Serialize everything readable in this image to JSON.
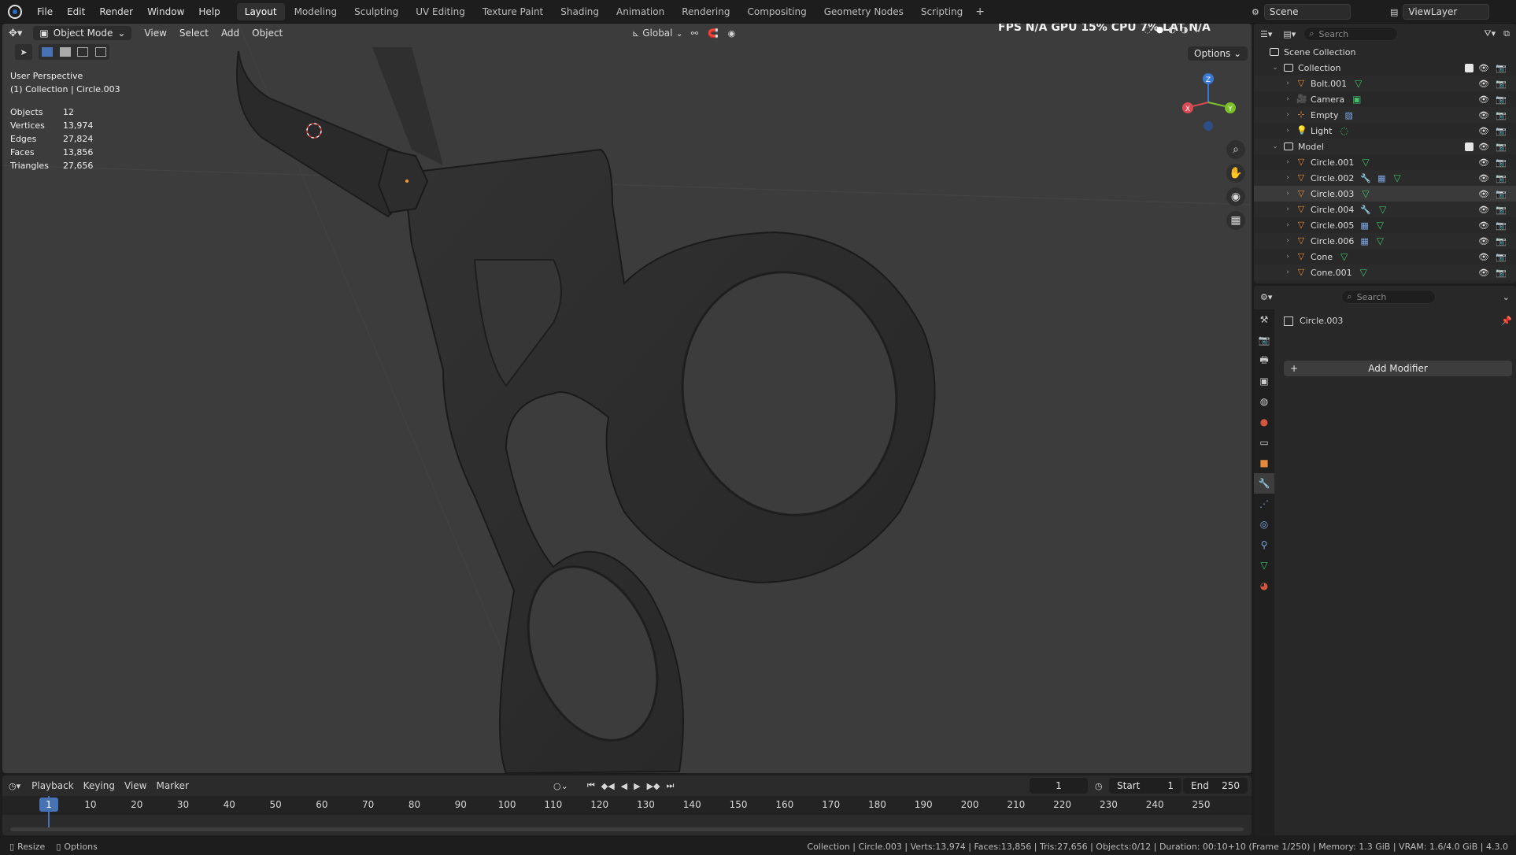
{
  "topbar": {
    "menu": [
      "File",
      "Edit",
      "Render",
      "Window",
      "Help"
    ],
    "workspaces": [
      {
        "label": "Layout",
        "active": true
      },
      {
        "label": "Modeling",
        "active": false
      },
      {
        "label": "Sculpting",
        "active": false
      },
      {
        "label": "UV Editing",
        "active": false
      },
      {
        "label": "Texture Paint",
        "active": false
      },
      {
        "label": "Shading",
        "active": false
      },
      {
        "label": "Animation",
        "active": false
      },
      {
        "label": "Rendering",
        "active": false
      },
      {
        "label": "Compositing",
        "active": false
      },
      {
        "label": "Geometry Nodes",
        "active": false
      },
      {
        "label": "Scripting",
        "active": false
      }
    ],
    "add_tab": "+",
    "scene": "Scene",
    "view_layer": "ViewLayer"
  },
  "viewport": {
    "mode": "Object Mode",
    "menus": [
      "View",
      "Select",
      "Add",
      "Object"
    ],
    "transform_orientation": "Global",
    "options_label": "Options",
    "perf_overlay": "FPS  N/A  GPU  15%  CPU  7%  LAT  N/A",
    "perspective": "User Perspective",
    "context": "(1) Collection | Circle.003",
    "stats": [
      {
        "label": "Objects",
        "value": "12"
      },
      {
        "label": "Vertices",
        "value": "13,974"
      },
      {
        "label": "Edges",
        "value": "27,824"
      },
      {
        "label": "Faces",
        "value": "13,856"
      },
      {
        "label": "Triangles",
        "value": "27,656"
      }
    ],
    "gizmo": {
      "z": "Z",
      "y": "Y",
      "x": "X"
    }
  },
  "outliner": {
    "search_placeholder": "Search",
    "root": "Scene Collection",
    "collections": [
      {
        "name": "Collection",
        "items": [
          {
            "name": "Bolt.001",
            "icon": "mesh",
            "extra": [
              "mesh"
            ]
          },
          {
            "name": "Camera",
            "icon": "camera",
            "extra": [
              "camera-data"
            ]
          },
          {
            "name": "Empty",
            "icon": "empty",
            "extra": [
              "image"
            ]
          },
          {
            "name": "Light",
            "icon": "light",
            "extra": [
              "light-data"
            ]
          }
        ]
      },
      {
        "name": "Model",
        "items": [
          {
            "name": "Circle.001",
            "icon": "mesh",
            "extra": [
              "mesh"
            ]
          },
          {
            "name": "Circle.002",
            "icon": "mesh",
            "extra": [
              "wrench",
              "modifier",
              "mesh"
            ]
          },
          {
            "name": "Circle.003",
            "icon": "mesh",
            "extra": [
              "mesh"
            ],
            "selected": true
          },
          {
            "name": "Circle.004",
            "icon": "mesh",
            "extra": [
              "wrench",
              "mesh"
            ]
          },
          {
            "name": "Circle.005",
            "icon": "mesh",
            "extra": [
              "modifier",
              "mesh"
            ]
          },
          {
            "name": "Circle.006",
            "icon": "mesh",
            "extra": [
              "modifier",
              "mesh"
            ]
          },
          {
            "name": "Cone",
            "icon": "mesh",
            "extra": [
              "mesh"
            ]
          },
          {
            "name": "Cone.001",
            "icon": "mesh",
            "extra": [
              "mesh"
            ]
          }
        ]
      }
    ]
  },
  "properties": {
    "search_placeholder": "Search",
    "object_name": "Circle.003",
    "add_modifier": "Add Modifier"
  },
  "timeline": {
    "menus": [
      "Playback",
      "Keying",
      "View",
      "Marker"
    ],
    "current_frame": "1",
    "start_label": "Start",
    "start": "1",
    "end_label": "End",
    "end": "250",
    "ticks": [
      "1",
      "10",
      "20",
      "30",
      "40",
      "50",
      "60",
      "70",
      "80",
      "90",
      "100",
      "110",
      "120",
      "130",
      "140",
      "150",
      "160",
      "170",
      "180",
      "190",
      "200",
      "210",
      "220",
      "230",
      "240",
      "250"
    ]
  },
  "statusbar": {
    "left": [
      "Resize",
      "Options"
    ],
    "right": "Collection | Circle.003 | Verts:13,974 | Faces:13,856 | Tris:27,656 | Objects:0/12 | Duration: 00:10+10 (Frame 1/250) | Memory: 1.3 GiB | VRAM: 1.6/4.0 GiB | 4.3.0"
  }
}
